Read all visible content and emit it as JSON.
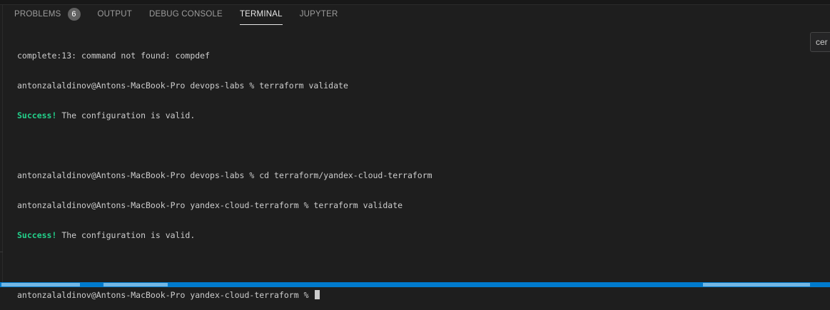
{
  "panel": {
    "tabs": [
      {
        "label": "PROBLEMS",
        "badge": "6"
      },
      {
        "label": "OUTPUT"
      },
      {
        "label": "DEBUG CONSOLE"
      },
      {
        "label": "TERMINAL",
        "active": true
      },
      {
        "label": "JUPYTER"
      }
    ]
  },
  "terminal": {
    "lines": [
      {
        "text": "complete:13: command not found: compdef"
      },
      {
        "text": "antonzalaldinov@Antons-MacBook-Pro devops-labs % terraform validate"
      },
      {
        "success": "Success!",
        "text": " The configuration is valid."
      },
      {
        "text": ""
      },
      {
        "text": "antonzalaldinov@Antons-MacBook-Pro devops-labs % cd terraform/yandex-cloud-terraform"
      },
      {
        "text": "antonzalaldinov@Antons-MacBook-Pro yandex-cloud-terraform % terraform validate"
      },
      {
        "success": "Success!",
        "text": " The configuration is valid."
      },
      {
        "text": ""
      },
      {
        "text": "antonzalaldinov@Antons-MacBook-Pro yandex-cloud-terraform % "
      }
    ]
  },
  "tooltip": {
    "text": "cer"
  },
  "colors": {
    "background": "#1e1e1e",
    "success": "#23d18b",
    "status_bar": "#007acc"
  }
}
